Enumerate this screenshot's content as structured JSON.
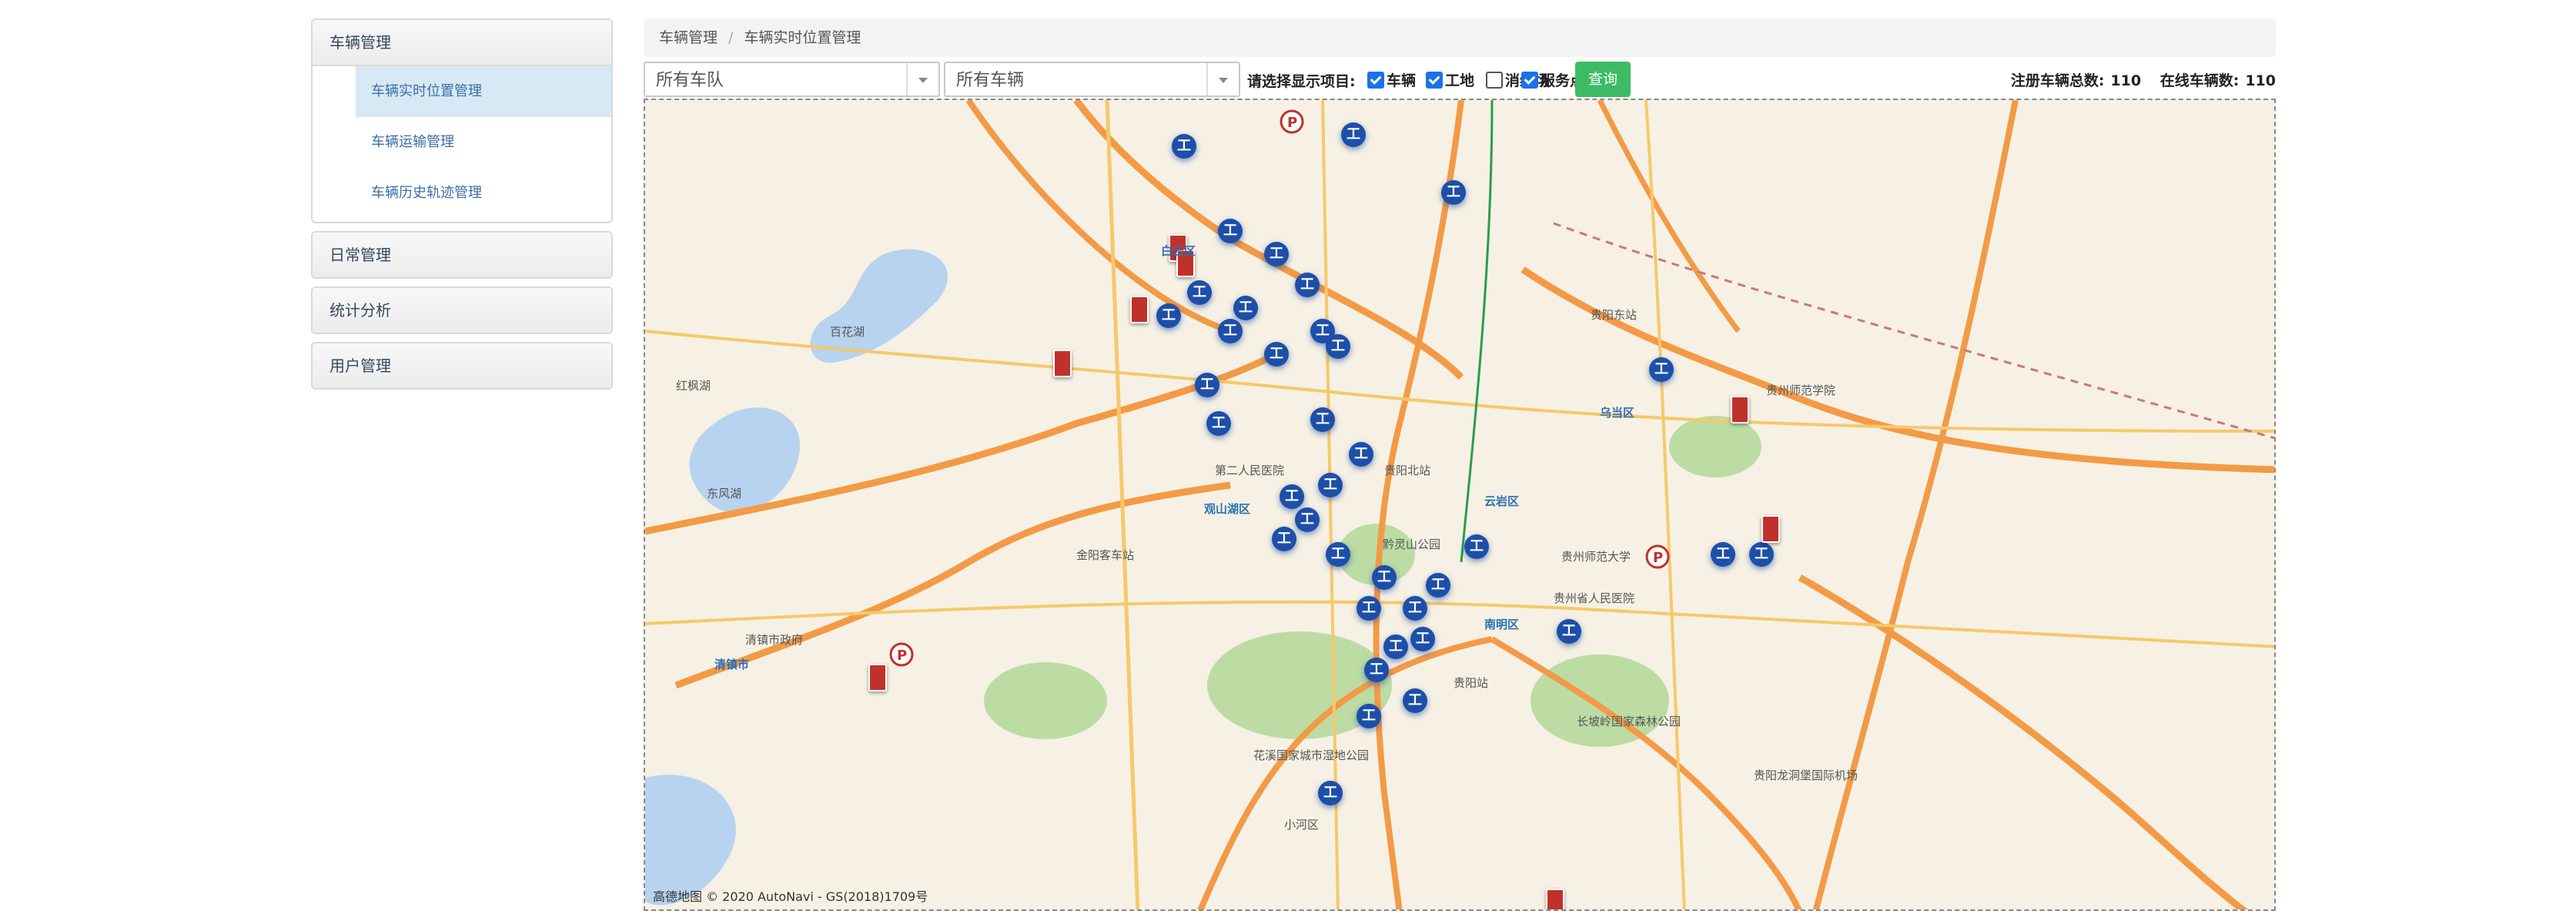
{
  "sidebar": {
    "sections": [
      {
        "title": "车辆管理",
        "items": [
          "车辆实时位置管理",
          "车辆运输管理",
          "车辆历史轨迹管理"
        ],
        "active_index": 0
      },
      {
        "title": "日常管理"
      },
      {
        "title": "统计分析"
      },
      {
        "title": "用户管理"
      }
    ]
  },
  "breadcrumb": {
    "root": "车辆管理",
    "current": "车辆实时位置管理"
  },
  "toolbar": {
    "fleet_select": "所有车队",
    "vehicle_select": "所有车辆",
    "filter_label": "请选择显示项目:",
    "checkboxes": [
      {
        "label": "车辆",
        "checked": true
      },
      {
        "label": "工地",
        "checked": true
      },
      {
        "label": "消纳场",
        "checked": false
      },
      {
        "label": "服务点",
        "checked": true
      }
    ],
    "query_button": "查询",
    "registered_label": "注册车辆总数:",
    "registered_value": "110",
    "online_label": "在线车辆数:",
    "online_value": "110"
  },
  "map": {
    "copyright": "高德地图 © 2020 AutoNavi - GS(2018)1709号",
    "labels": [
      "白云区",
      "观山湖区",
      "云岩区",
      "南明区",
      "乌当区",
      "清镇市",
      "花溪国家城市湿地公园",
      "贵阳东站",
      "贵阳北站",
      "贵阳站",
      "清镇市政府",
      "黔灵山公园",
      "小河区",
      "贵阳龙洞堡国际机场",
      "金阳客车站",
      "第二人民医院",
      "贵州省人民医院",
      "贵州师范学院",
      "贵州师范大学",
      "长坡岭国家森林公园",
      "红枫湖",
      "百花湖",
      "东风湖"
    ],
    "colors": {
      "worksite": "#1e4fa8",
      "vehicle": "#c0312b",
      "road_major": "#f39a46",
      "water": "#b7d3ef",
      "park": "#bcdca4"
    }
  }
}
